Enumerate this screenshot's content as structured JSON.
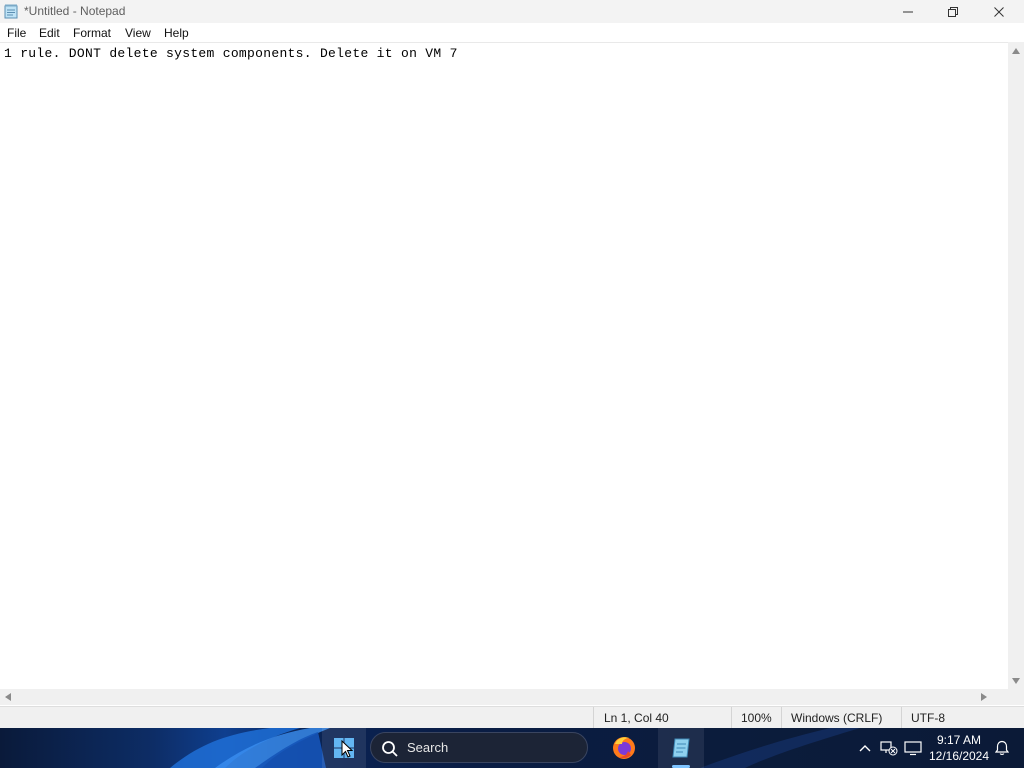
{
  "window": {
    "title": "*Untitled - Notepad",
    "icon": "notepad-icon"
  },
  "menu": {
    "items": [
      {
        "label": "File"
      },
      {
        "label": "Edit"
      },
      {
        "label": "Format"
      },
      {
        "label": "View"
      },
      {
        "label": "Help"
      }
    ]
  },
  "editor": {
    "content": "1 rule. DONT delete system components. Delete it on VM 7"
  },
  "status": {
    "position": "Ln 1, Col 40",
    "zoom": "100%",
    "line_ending": "Windows (CRLF)",
    "encoding": "UTF-8"
  },
  "taskbar": {
    "search_label": "Search",
    "clock_time": "9:17 AM",
    "clock_date": "12/16/2024",
    "pinned": [
      "windows-start-icon",
      "firefox-icon",
      "notepad-icon"
    ],
    "tray": [
      "chevron-up-icon",
      "network-icon",
      "display-icon",
      "notification-bell-icon"
    ]
  },
  "colors": {
    "accent": "#7fc4ff",
    "titlebar": "#f3f3f3",
    "statusbar": "#f0f0f0"
  }
}
